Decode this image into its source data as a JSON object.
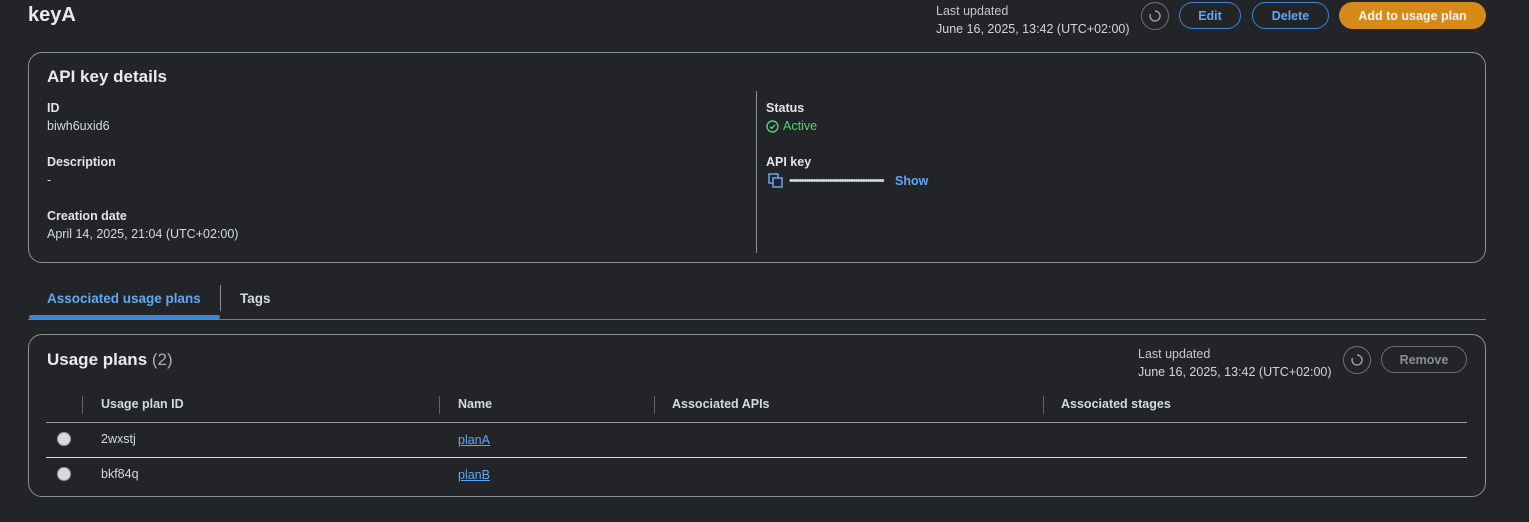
{
  "header": {
    "title": "keyA",
    "last_updated_label": "Last updated",
    "last_updated_value": "June 16, 2025, 13:42 (UTC+02:00)",
    "refresh_icon": "refresh-icon",
    "edit_label": "Edit",
    "delete_label": "Delete",
    "add_label": "Add to usage plan"
  },
  "details": {
    "title": "API key details",
    "id_label": "ID",
    "id_value": "biwh6uxid6",
    "description_label": "Description",
    "description_value": "-",
    "creation_label": "Creation date",
    "creation_value": "April 14, 2025, 21:04 (UTC+02:00)",
    "status_label": "Status",
    "status_value": "Active",
    "status_color": "#52d373",
    "apikey_label": "API key",
    "apikey_masked": "••••••••••••••••••••••••••••••••••••••••",
    "show_label": "Show",
    "copy_icon": "copy-icon"
  },
  "tabs": {
    "items": [
      {
        "label": "Associated usage plans",
        "active": true
      },
      {
        "label": "Tags",
        "active": false
      }
    ]
  },
  "usage_plans": {
    "title": "Usage plans",
    "count": "(2)",
    "last_updated_label": "Last updated",
    "last_updated_value": "June 16, 2025, 13:42 (UTC+02:00)",
    "remove_label": "Remove",
    "columns": [
      "Usage plan ID",
      "Name",
      "Associated APIs",
      "Associated stages"
    ],
    "rows": [
      {
        "id": "2wxstj",
        "name": "planA",
        "apis": "",
        "stages": ""
      },
      {
        "id": "bkf84q",
        "name": "planB",
        "apis": "",
        "stages": ""
      }
    ]
  },
  "colors": {
    "accent": "#3a86d9",
    "primary_button": "#d68a1a",
    "background": "#232427"
  }
}
